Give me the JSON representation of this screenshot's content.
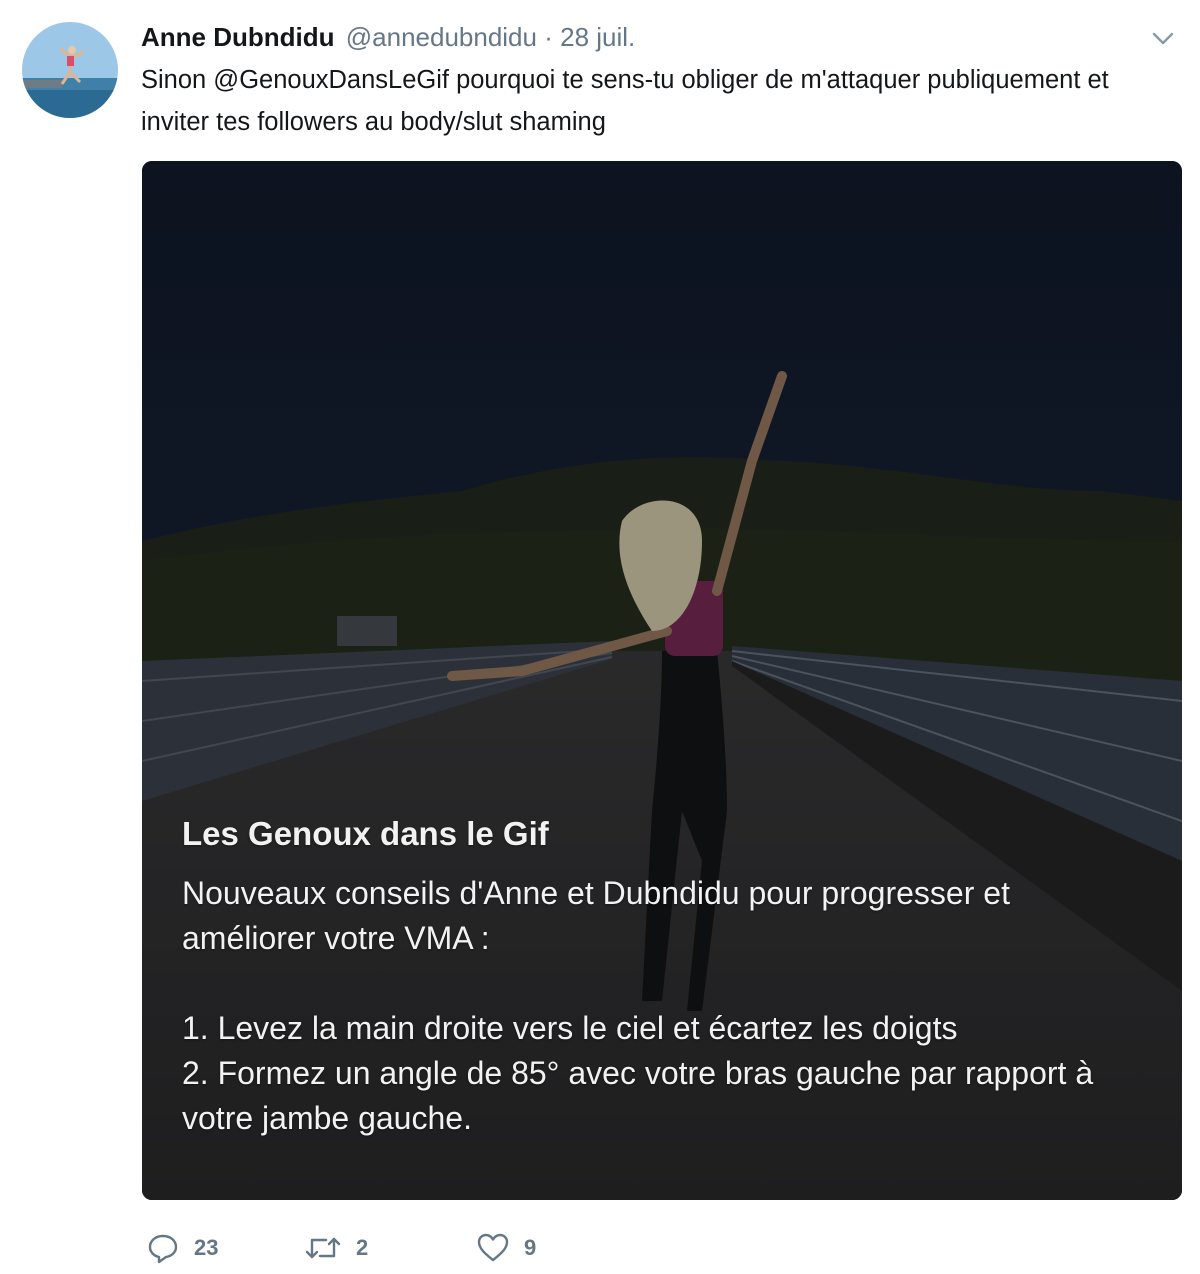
{
  "tweet": {
    "display_name": "Anne Dubndidu",
    "handle": "@annedubndidu",
    "separator": "·",
    "date": "28 juil.",
    "text": "Sinon @GenouxDansLeGif pourquoi te sens-tu obliger de m'attaquer publiquement et inviter tes followers au body/slut shaming"
  },
  "media": {
    "overlay_title": "Les Genoux dans le Gif",
    "overlay_lines": [
      "Nouveaux conseils d'Anne et Dubndidu pour progresser et améliorer votre VMA :",
      "",
      "1. Levez la main droite vers le ciel et écartez les doigts",
      "2. Formez un angle de 85° avec votre bras gauche par rapport à votre jambe gauche."
    ]
  },
  "actions": {
    "reply_count": "23",
    "retweet_count": "2",
    "like_count": "9"
  },
  "icons": {
    "caret": "chevron-down-icon",
    "reply": "reply-icon",
    "retweet": "retweet-icon",
    "like": "heart-icon"
  },
  "colors": {
    "text_primary": "#14171a",
    "text_secondary": "#657786",
    "overlay_text": "#f2f2f2",
    "sky": "#141f33"
  }
}
